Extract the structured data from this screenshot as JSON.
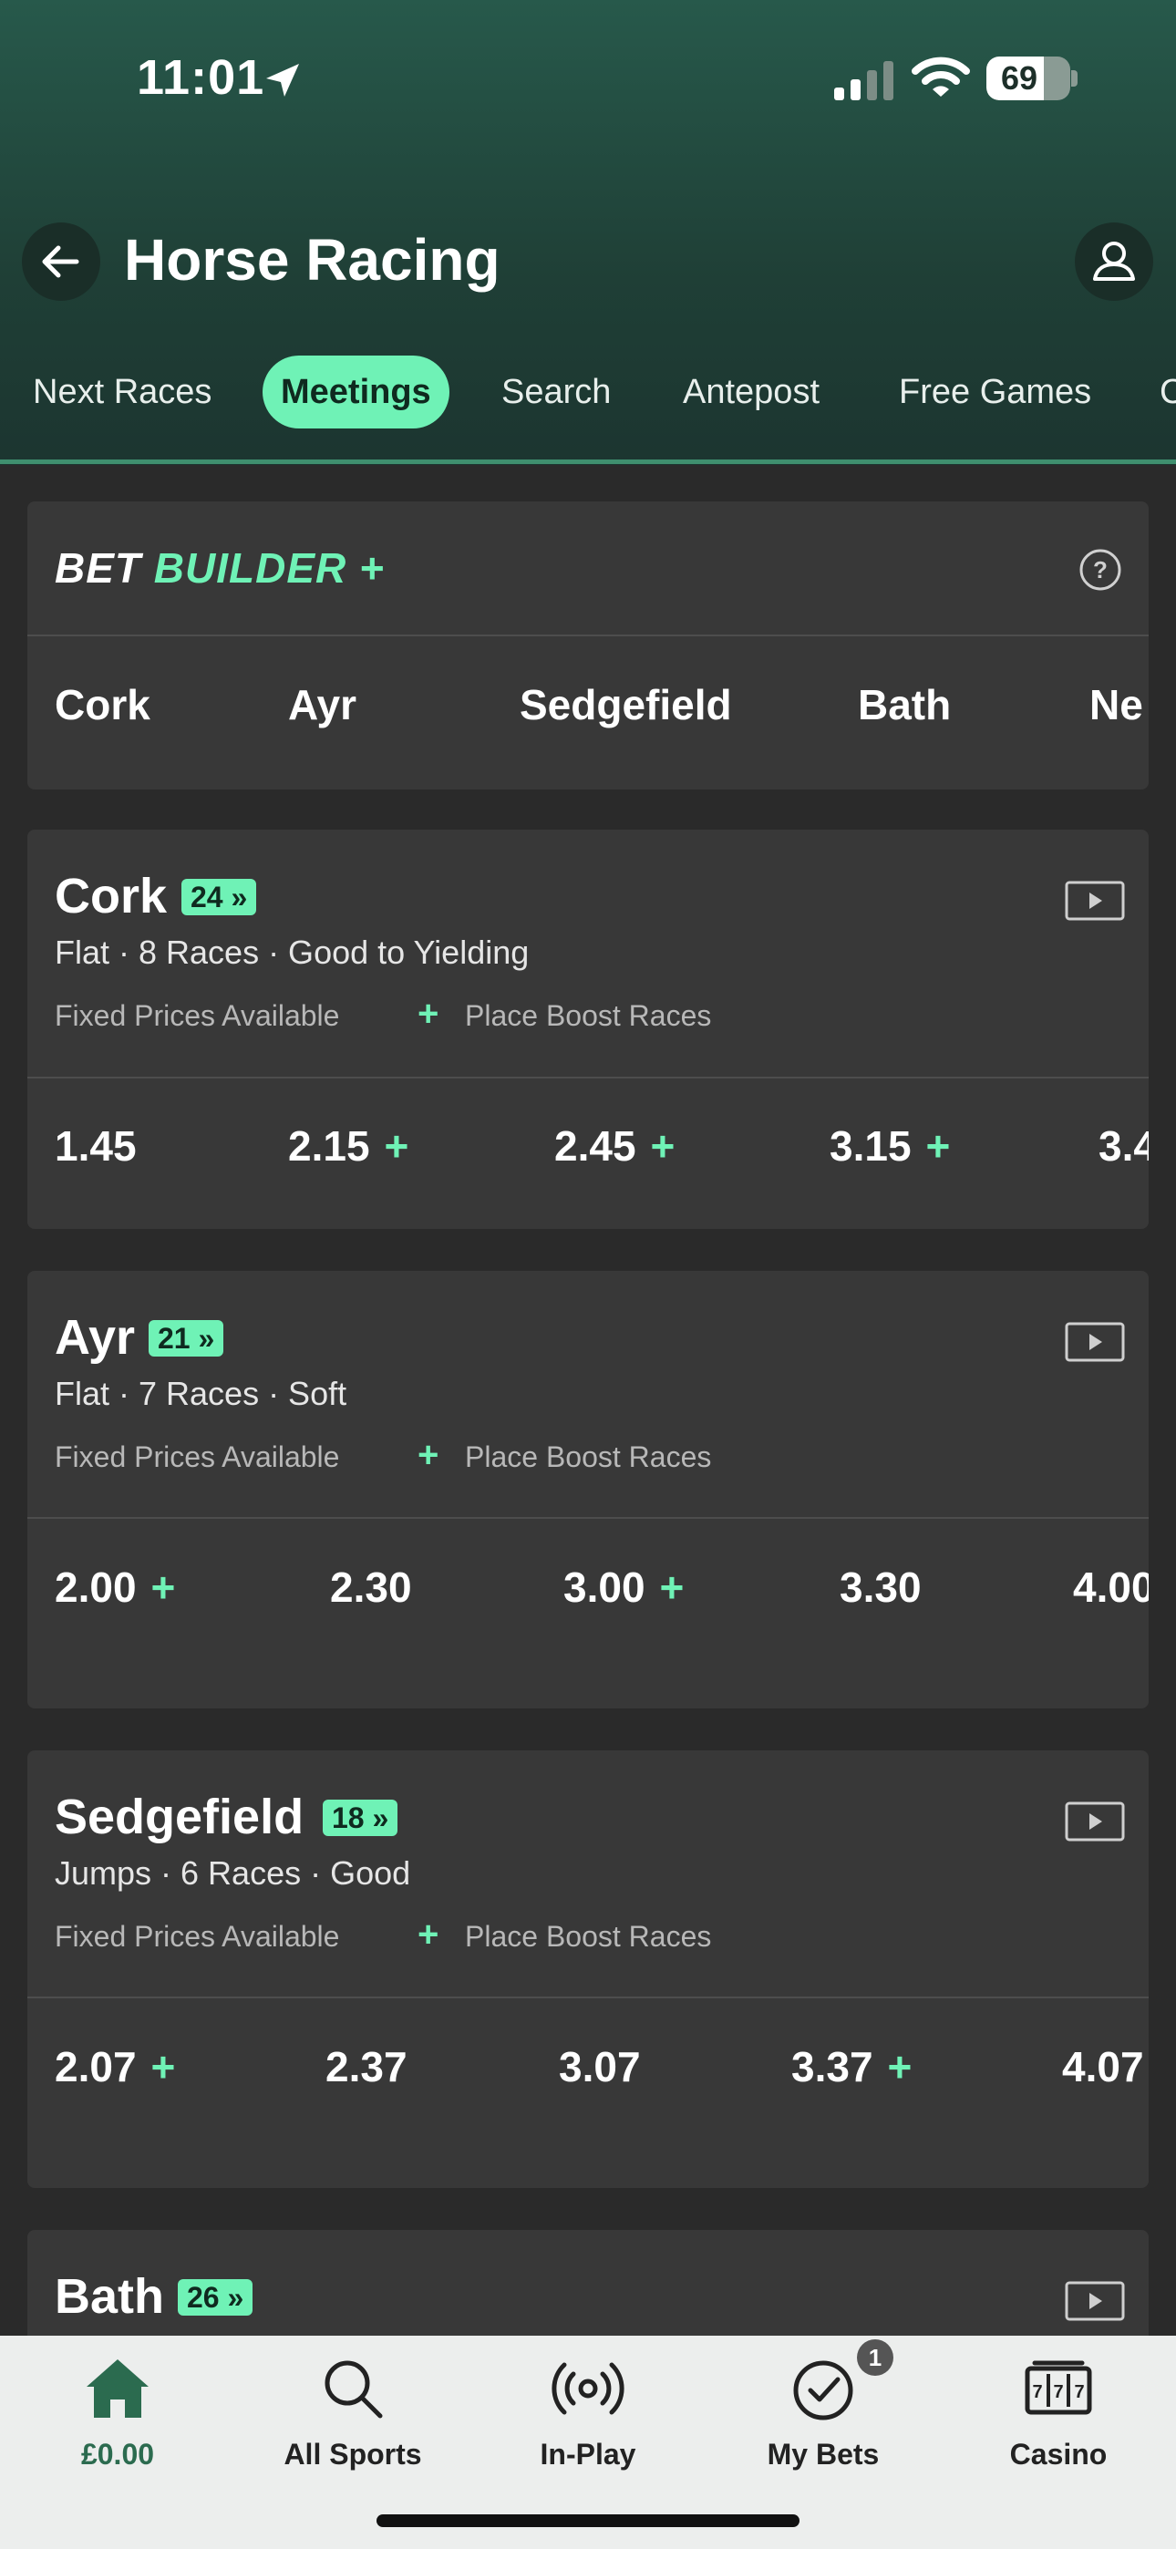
{
  "status_bar": {
    "time": "11:01",
    "battery": "69",
    "battery_level": 0.69
  },
  "header": {
    "title": "Horse Racing"
  },
  "tabs": [
    {
      "label": "Next Races",
      "active": false
    },
    {
      "label": "Meetings",
      "active": true
    },
    {
      "label": "Search",
      "active": false
    },
    {
      "label": "Antepost",
      "active": false
    },
    {
      "label": "Free Games",
      "active": false
    },
    {
      "label": "C",
      "active": false
    }
  ],
  "bet_builder": {
    "logo_part1": "BET",
    "logo_part2": "BUILDER +",
    "meetings": [
      "Cork",
      "Ayr",
      "Sedgefield",
      "Bath",
      "Ne"
    ]
  },
  "meetings": [
    {
      "name": "Cork",
      "badge": "24 »",
      "details": "Flat · 8 Races · Good to Yielding",
      "fixed_prices": "Fixed Prices Available",
      "boost_plus": "+",
      "boost": "Place Boost Races",
      "odds": [
        {
          "value": "1.45",
          "plus": ""
        },
        {
          "value": "2.15",
          "plus": "+"
        },
        {
          "value": "2.45",
          "plus": "+"
        },
        {
          "value": "3.15",
          "plus": "+"
        },
        {
          "value": "3.4",
          "plus": ""
        }
      ]
    },
    {
      "name": "Ayr",
      "badge": "21 »",
      "details": "Flat · 7 Races · Soft",
      "fixed_prices": "Fixed Prices Available",
      "boost_plus": "+",
      "boost": "Place Boost Races",
      "odds": [
        {
          "value": "2.00",
          "plus": "+"
        },
        {
          "value": "2.30",
          "plus": ""
        },
        {
          "value": "3.00",
          "plus": "+"
        },
        {
          "value": "3.30",
          "plus": ""
        },
        {
          "value": "4.00",
          "plus": ""
        }
      ]
    },
    {
      "name": "Sedgefield",
      "badge": "18 »",
      "details": "Jumps · 6 Races · Good",
      "fixed_prices": "Fixed Prices Available",
      "boost_plus": "+",
      "boost": "Place Boost Races",
      "odds": [
        {
          "value": "2.07",
          "plus": "+"
        },
        {
          "value": "2.37",
          "plus": ""
        },
        {
          "value": "3.07",
          "plus": ""
        },
        {
          "value": "3.37",
          "plus": "+"
        },
        {
          "value": "4.07",
          "plus": ""
        }
      ]
    },
    {
      "name": "Bath",
      "badge": "26 »"
    }
  ],
  "bottom_nav": [
    {
      "label": "£0.00",
      "icon": "home-icon",
      "active": true
    },
    {
      "label": "All Sports",
      "icon": "search-icon",
      "active": false
    },
    {
      "label": "In-Play",
      "icon": "broadcast-icon",
      "active": false
    },
    {
      "label": "My Bets",
      "icon": "checkmark-circle-icon",
      "active": false,
      "badge": "1"
    },
    {
      "label": "Casino",
      "icon": "slot-machine-icon",
      "active": false
    }
  ],
  "colors": {
    "accent": "#6ff2b6",
    "header": "#27594b",
    "card": "#383838",
    "background": "#2a2a2a",
    "nav": "#eceeed"
  }
}
